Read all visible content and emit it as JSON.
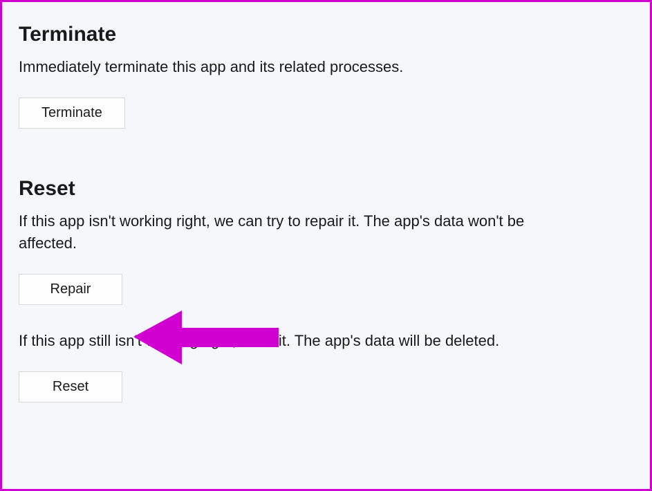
{
  "terminate": {
    "title": "Terminate",
    "description": "Immediately terminate this app and its related processes.",
    "button_label": "Terminate"
  },
  "reset": {
    "title": "Reset",
    "repair_description": "If this app isn't working right, we can try to repair it. The app's data won't be affected.",
    "repair_button_label": "Repair",
    "reset_description": "If this app still isn't working right, reset it. The app's data will be deleted.",
    "reset_button_label": "Reset"
  },
  "annotation": {
    "arrow_color": "#d000d0"
  }
}
